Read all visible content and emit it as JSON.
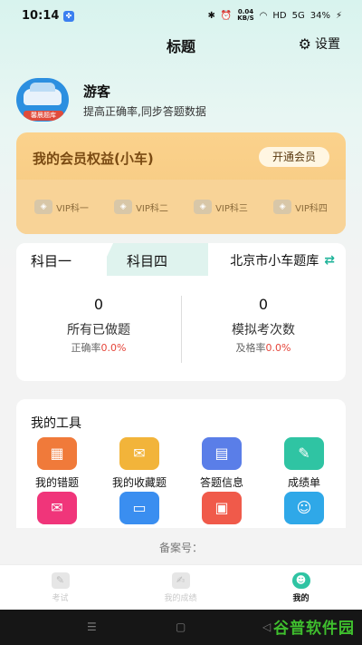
{
  "status": {
    "time": "10:14",
    "app_badge": "✤",
    "speed_value": "0.04",
    "speed_unit": "KB/S",
    "network": "HD",
    "signal": "5G",
    "battery": "34%"
  },
  "header": {
    "title": "标题",
    "settings_label": "设置"
  },
  "profile": {
    "avatar_tag": "馨晨题库",
    "name": "游客",
    "description": "提高正确率,同步答题数据"
  },
  "vip": {
    "title": "我的会员权益(小车)",
    "button_label": "开通会员",
    "items": [
      {
        "label": "VIP科一"
      },
      {
        "label": "VIP科二"
      },
      {
        "label": "VIP科三"
      },
      {
        "label": "VIP科四"
      }
    ]
  },
  "subject": {
    "tabs": [
      {
        "label": "科目一"
      },
      {
        "label": "科目四"
      }
    ],
    "question_bank": "北京市小车题库",
    "stats": [
      {
        "value": "0",
        "label": "所有已做题",
        "rate_label": "正确率",
        "rate_value": "0.0%"
      },
      {
        "value": "0",
        "label": "模拟考次数",
        "rate_label": "及格率",
        "rate_value": "0.0%"
      }
    ]
  },
  "tools": {
    "title": "我的工具",
    "items": [
      {
        "label": "我的错题",
        "icon": "wrong-questions-icon",
        "color": "#f07a3a"
      },
      {
        "label": "我的收藏题",
        "icon": "favorites-icon",
        "color": "#f2b43a"
      },
      {
        "label": "答题信息",
        "icon": "answer-info-icon",
        "color": "#5a7ee8"
      },
      {
        "label": "成绩单",
        "icon": "transcript-icon",
        "color": "#2fc4a3"
      },
      {
        "label": "",
        "icon": "message-icon",
        "color": "#f0357a"
      },
      {
        "label": "",
        "icon": "chat-icon",
        "color": "#3a8ef0"
      },
      {
        "label": "",
        "icon": "profile-card-icon",
        "color": "#f05a4a"
      },
      {
        "label": "",
        "icon": "customer-service-icon",
        "color": "#2fa8e8"
      }
    ]
  },
  "footer": {
    "beian": "备案号："
  },
  "tabbar": {
    "items": [
      {
        "label": "考试"
      },
      {
        "label": "我的成绩"
      },
      {
        "label": "我的"
      }
    ]
  },
  "watermark": "谷普软件园"
}
